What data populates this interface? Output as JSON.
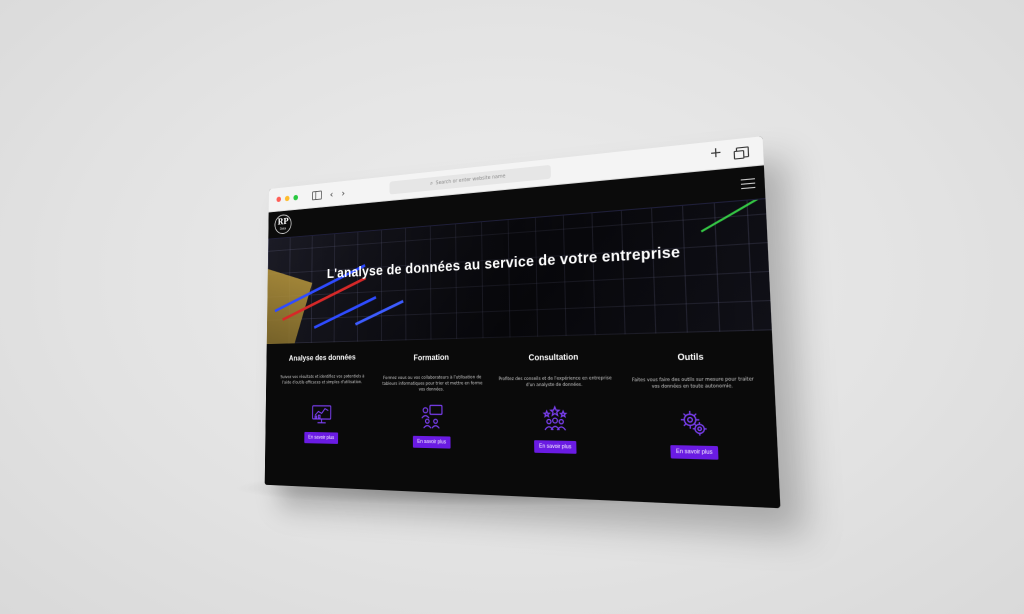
{
  "browser": {
    "url_placeholder": "Search or enter website name",
    "back_glyph": "‹",
    "forward_glyph": "›",
    "new_tab_glyph": "+",
    "traffic_lights": [
      "#ff5f57",
      "#febc2e",
      "#28c840"
    ]
  },
  "site": {
    "logo": {
      "mark": "RP",
      "text": "Data"
    },
    "hero_title": "L'analyse de données au service de votre entreprise",
    "accent_color": "#6a1be3",
    "services": [
      {
        "title": "Analyse des données",
        "description": "Suivez vos résultats et identifiez vos potentiels à l'aide d'outils efficaces et simples d'utilisation.",
        "icon": "analytics-dashboard-icon",
        "button": "En savoir plus"
      },
      {
        "title": "Formation",
        "description": "Formez vous ou vos collaborateurs à l'utilisation de tableurs informatiques pour trier et mettre en forme vos données.",
        "icon": "training-presentation-icon",
        "button": "En savoir plus"
      },
      {
        "title": "Consultation",
        "description": "Profitez des conseils et de l'expérience en entreprise d'un analyste de données.",
        "icon": "team-rating-icon",
        "button": "En savoir plus"
      },
      {
        "title": "Outils",
        "description": "Faites vous faire des outils sur mesure pour traiter vos données en toute autonomie.",
        "icon": "gears-tools-icon",
        "button": "En savoir plus"
      }
    ]
  }
}
